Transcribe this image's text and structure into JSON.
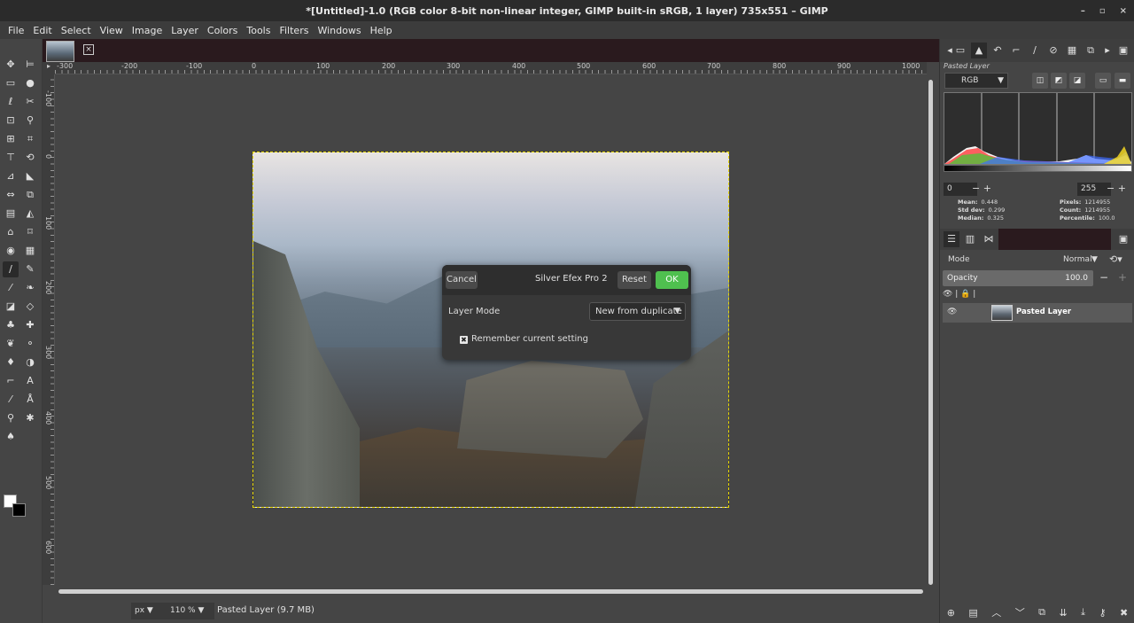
{
  "window": {
    "title": "*[Untitled]-1.0 (RGB color 8-bit non-linear integer, GIMP built-in sRGB, 1 layer) 735x551 – GIMP",
    "controls": [
      "–",
      "▫",
      "×"
    ]
  },
  "menu": [
    "File",
    "Edit",
    "Select",
    "View",
    "Image",
    "Layer",
    "Colors",
    "Tools",
    "Filters",
    "Windows",
    "Help"
  ],
  "rulers": {
    "h_labels": [
      "-300",
      "-200",
      "-100",
      "0",
      "100",
      "200",
      "300",
      "400",
      "500",
      "600",
      "700",
      "800",
      "900",
      "1000"
    ],
    "v_labels": [
      "-100",
      "0",
      "100",
      "200",
      "300",
      "400",
      "500",
      "600"
    ]
  },
  "status": {
    "unit": "px",
    "zoom": "110 %",
    "text": "Pasted Layer (9.7 MB)"
  },
  "dialog": {
    "title": "Silver Efex Pro 2",
    "cancel": "Cancel",
    "reset": "Reset",
    "ok": "OK",
    "layer_mode_label": "Layer Mode",
    "layer_mode_value": "New from duplicate",
    "remember_label": "Remember current setting",
    "remember_checked": true
  },
  "histogram_panel": {
    "title": "Pasted Layer",
    "channel": "RGB",
    "range_min": "0",
    "range_max": "255",
    "stats_left": [
      {
        "label": "Mean:",
        "value": "0.448"
      },
      {
        "label": "Std dev:",
        "value": "0.299"
      },
      {
        "label": "Median:",
        "value": "0.325"
      }
    ],
    "stats_right": [
      {
        "label": "Pixels:",
        "value": "1214955"
      },
      {
        "label": "Count:",
        "value": "1214955"
      },
      {
        "label": "Percentile:",
        "value": "100.0"
      }
    ]
  },
  "layers_panel": {
    "mode_label": "Mode",
    "mode_value": "Normal",
    "opacity_label": "Opacity",
    "opacity_value": "100.0",
    "layers": [
      {
        "name": "Pasted Layer",
        "visible": true
      }
    ]
  },
  "colors": {
    "foreground": "#ffffff",
    "background": "#000000",
    "ok_button": "#4fc04f",
    "selection_outline": "#e8d800"
  }
}
